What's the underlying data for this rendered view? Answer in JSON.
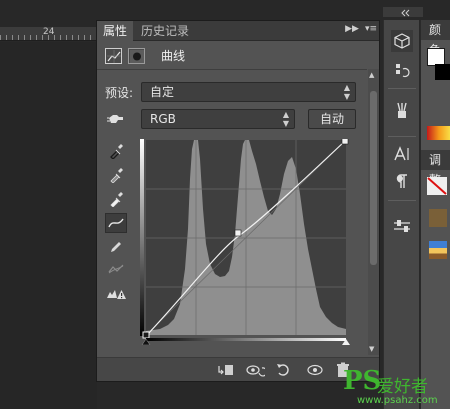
{
  "ruler": {
    "mark": "24"
  },
  "panel": {
    "tabs": [
      {
        "label": "属性",
        "active": true
      },
      {
        "label": "历史记录",
        "active": false
      }
    ],
    "header_title": "曲线",
    "preset_label": "预设:",
    "preset_value": "自定",
    "channel_value": "RGB",
    "auto_button": "自动",
    "tools": [
      "sample-black-point",
      "sample-gray-point",
      "sample-white-point",
      "curve-edit",
      "pencil",
      "smooth",
      "clipping-warning"
    ],
    "selected_tool": "curve-edit"
  },
  "side_panels": {
    "top_tab": "颜色",
    "bottom_tab": "调整"
  },
  "watermark": {
    "ps": "PS",
    "cn": "爱好者",
    "url": "www.psahz.com"
  },
  "colors": {
    "panel_bg": "#535353",
    "dark_bg": "#282828",
    "accent_green": "#3fb52f"
  }
}
